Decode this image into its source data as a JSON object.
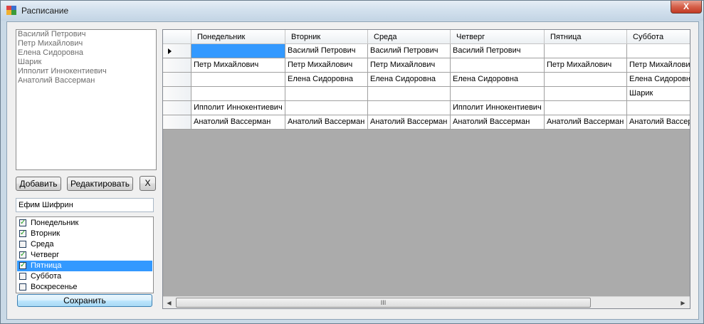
{
  "window": {
    "title": "Расписание",
    "close_label": "X"
  },
  "names_list": {
    "items": [
      "Василий Петрович",
      "Петр Михайлович",
      "Елена Сидоровна",
      "Шарик",
      "Ипполит Иннокентиевич",
      "Анатолий Вассерман"
    ]
  },
  "buttons": {
    "add": "Добавить",
    "edit": "Редактировать",
    "delete": "X",
    "save": "Сохранить"
  },
  "name_input": {
    "value": "Ефим Шифрин"
  },
  "days_checklist": {
    "items": [
      {
        "label": "Понедельник",
        "checked": true
      },
      {
        "label": "Вторник",
        "checked": true
      },
      {
        "label": "Среда",
        "checked": false
      },
      {
        "label": "Четверг",
        "checked": true
      },
      {
        "label": "Пятница",
        "checked": true,
        "selected": true
      },
      {
        "label": "Суббота",
        "checked": false
      },
      {
        "label": "Воскресенье",
        "checked": false
      }
    ]
  },
  "grid": {
    "columns": [
      "Понедельник",
      "Вторник",
      "Среда",
      "Четверг",
      "Пятница",
      "Суббота"
    ],
    "rows": [
      [
        "",
        "Василий Петрович",
        "Василий Петрович",
        "Василий Петрович",
        "",
        ""
      ],
      [
        "Петр Михайлович",
        "Петр Михайлович",
        "Петр Михайлович",
        "",
        "Петр Михайлович",
        "Петр Михайлович"
      ],
      [
        "",
        "Елена Сидоровна",
        "Елена Сидоровна",
        "Елена Сидоровна",
        "",
        "Елена Сидоровна"
      ],
      [
        "",
        "",
        "",
        "",
        "",
        "Шарик"
      ],
      [
        "Ипполит Иннокентиевич",
        "",
        "",
        "Ипполит Иннокентиевич",
        "",
        ""
      ],
      [
        "Анатолий Вассерман",
        "Анатолий Вассерман",
        "Анатолий Вассерман",
        "Анатолий Вассерман",
        "Анатолий Вассерман",
        "Анатолий Вассерман"
      ]
    ],
    "current_row": 0,
    "selected_cell": [
      0,
      0
    ],
    "scroll_thumb_glyph": "III"
  },
  "colors": {
    "selection": "#3399ff",
    "grid_background": "#ababab"
  }
}
